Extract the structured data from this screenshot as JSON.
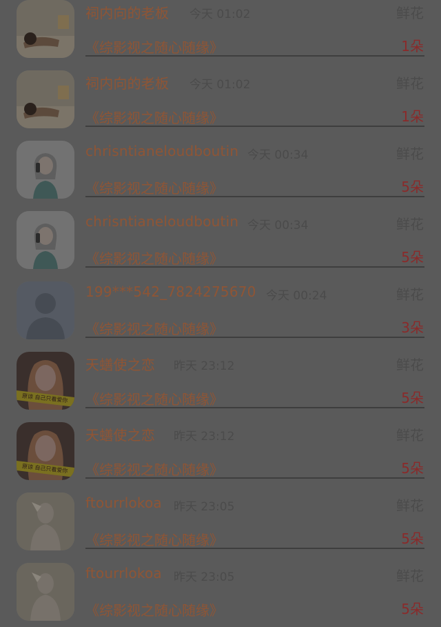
{
  "gift_records": [
    {
      "user_name": "祠内向的老板",
      "time": "今天 01:02",
      "gift_type": "鲜花",
      "work_title": "《综影视之随心随缘》",
      "quantity": "1朵",
      "avatar_icon": "avatar-sleeping-cartoon"
    },
    {
      "user_name": "祠内向的老板",
      "time": "今天 01:02",
      "gift_type": "鲜花",
      "work_title": "《综影视之随心随缘》",
      "quantity": "1朵",
      "avatar_icon": "avatar-sleeping-cartoon"
    },
    {
      "user_name": "chrisntianeloudboutin",
      "time": "今天 00:34",
      "gift_type": "鲜花",
      "work_title": "《综影视之随心随缘》",
      "quantity": "5朵",
      "avatar_icon": "avatar-girl-phone-illustration"
    },
    {
      "user_name": "chrisntianeloudboutin",
      "time": "今天 00:34",
      "gift_type": "鲜花",
      "work_title": "《综影视之随心随缘》",
      "quantity": "5朵",
      "avatar_icon": "avatar-girl-phone-illustration"
    },
    {
      "user_name": "199***542_7824275670",
      "time": "今天 00:24",
      "gift_type": "鲜花",
      "work_title": "《综影视之随心随缘》",
      "quantity": "3朵",
      "avatar_icon": "avatar-default-silhouette"
    },
    {
      "user_name": "天蟮使之恋",
      "time": "昨天 23:12",
      "gift_type": "鲜花",
      "work_title": "《综影视之随心随缘》",
      "quantity": "5朵",
      "avatar_icon": "avatar-girl-photo-banner"
    },
    {
      "user_name": "天蟮使之恋",
      "time": "昨天 23:12",
      "gift_type": "鲜花",
      "work_title": "《综影视之随心随缘》",
      "quantity": "5朵",
      "avatar_icon": "avatar-girl-photo-banner"
    },
    {
      "user_name": "ftourrlokoa",
      "time": "昨天 23:05",
      "gift_type": "鲜花",
      "work_title": "《综影视之随心随缘》",
      "quantity": "5朵",
      "avatar_icon": "avatar-man-sketch"
    },
    {
      "user_name": "ftourrlokoa",
      "time": "昨天 23:05",
      "gift_type": "鲜花",
      "work_title": "《综影视之随心随缘》",
      "quantity": "5朵",
      "avatar_icon": "avatar-man-sketch"
    }
  ],
  "avatar_banner_text": "原谅 自己只看爱你",
  "colors": {
    "overlay_bg": "#5a5a5a",
    "name": "#8f5535",
    "muted": "#4b4b4b",
    "quantity": "#8a2a2a"
  }
}
